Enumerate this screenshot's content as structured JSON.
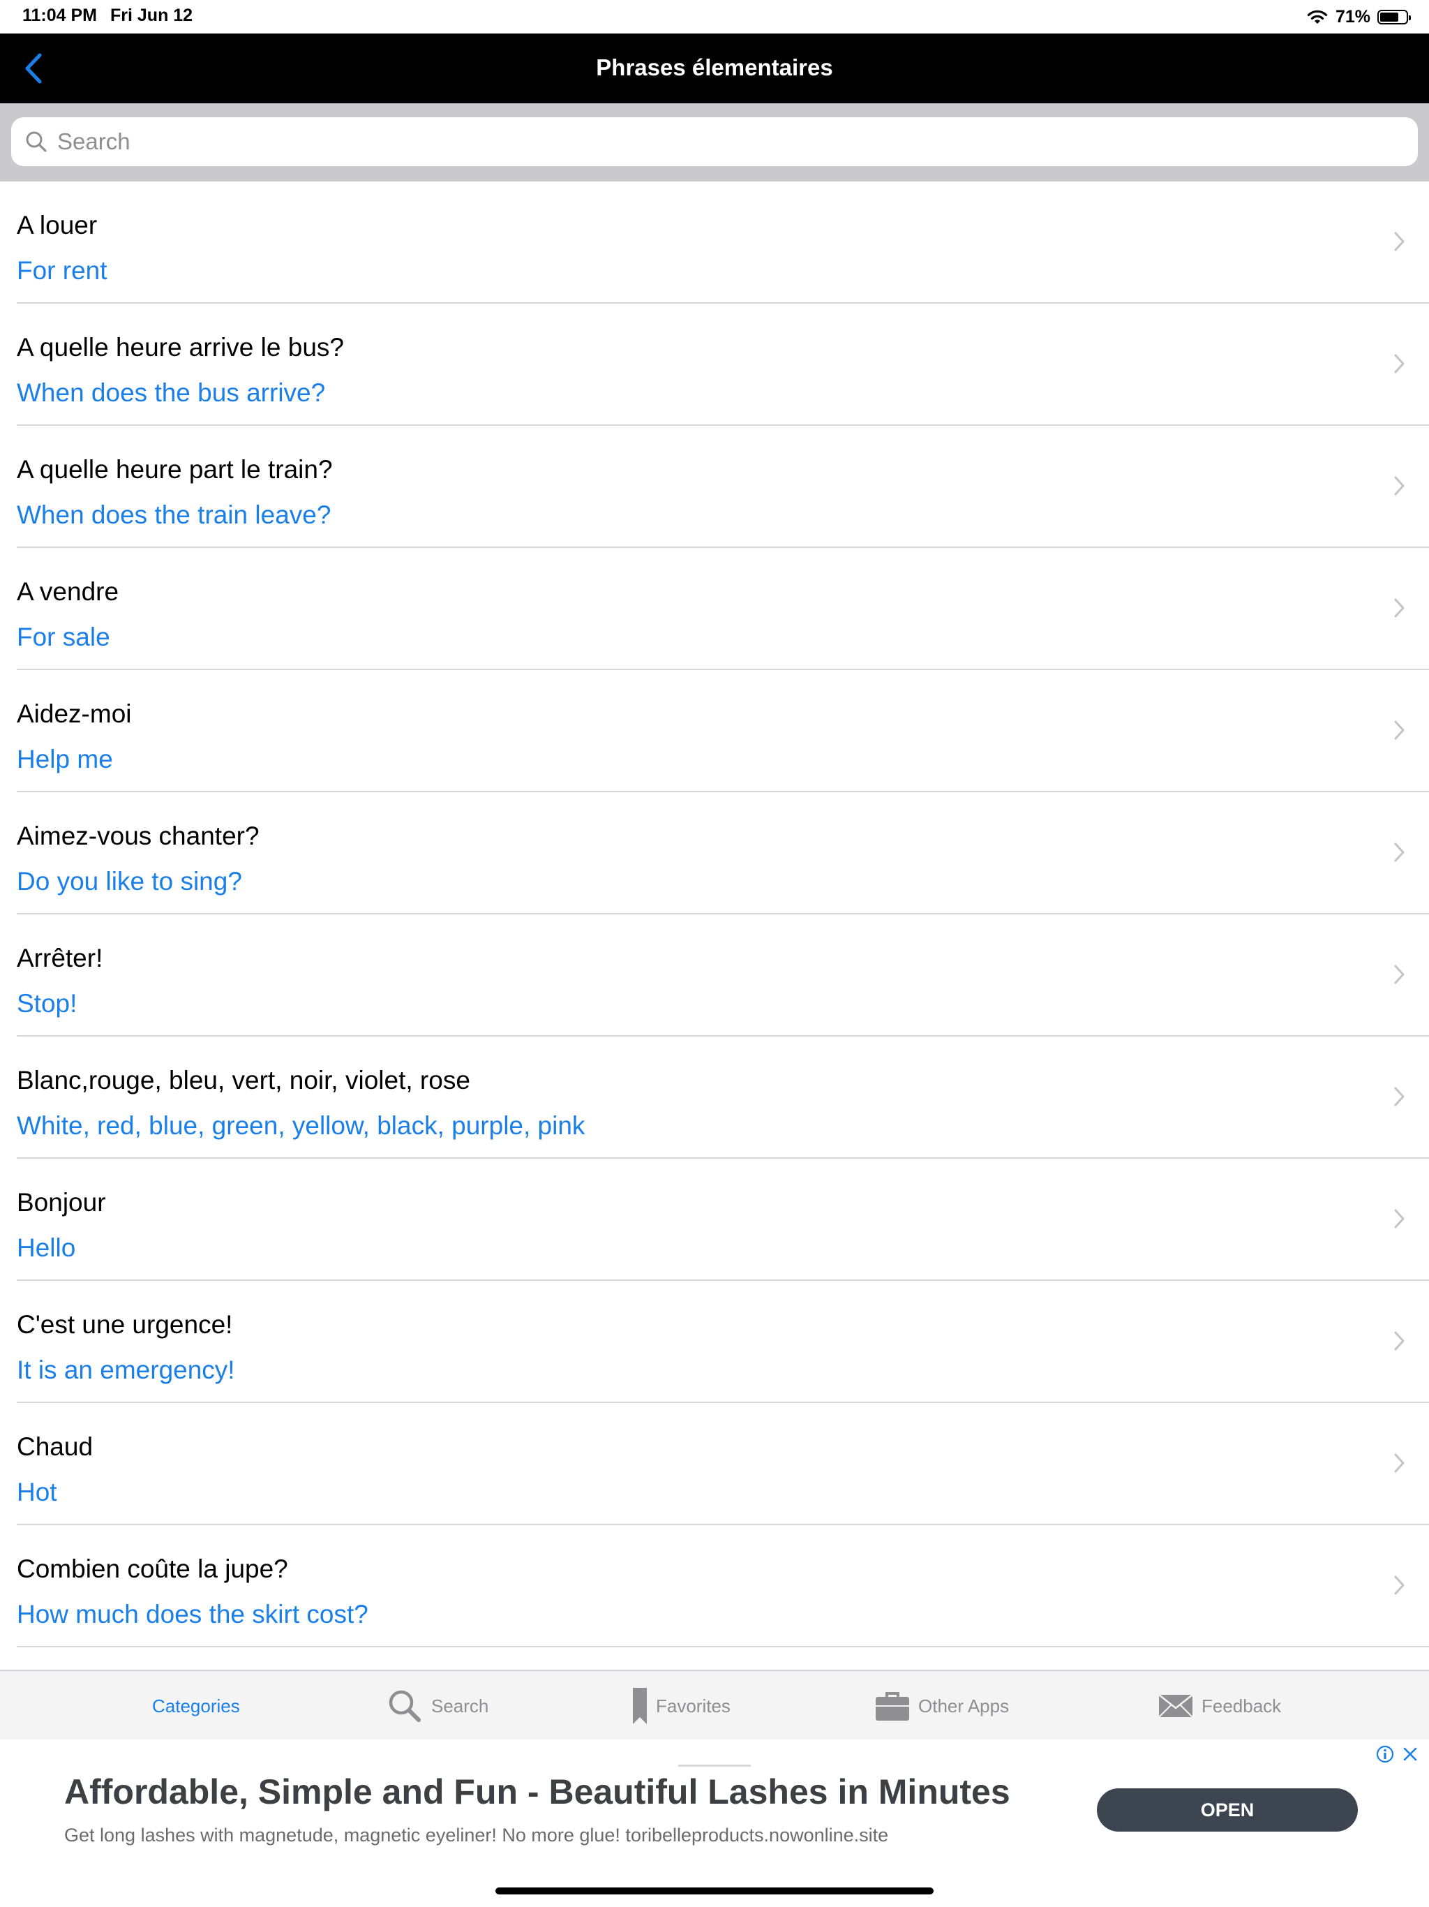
{
  "status_bar": {
    "time": "11:04 PM",
    "date": "Fri Jun 12",
    "battery": "71%",
    "battery_level": 0.71
  },
  "nav": {
    "title": "Phrases élementaires",
    "back_icon": "chevron-left-icon"
  },
  "search": {
    "placeholder": "Search",
    "value": ""
  },
  "phrases": [
    {
      "fr": "A louer",
      "en": "For rent"
    },
    {
      "fr": "A quelle heure arrive le bus?",
      "en": "When does the bus arrive?"
    },
    {
      "fr": "A quelle heure part le train?",
      "en": "When does the train leave?"
    },
    {
      "fr": "A vendre",
      "en": "For sale"
    },
    {
      "fr": "Aidez-moi",
      "en": "Help me"
    },
    {
      "fr": "Aimez-vous chanter?",
      "en": "Do you like to sing?"
    },
    {
      "fr": "Arrêter!",
      "en": "Stop!"
    },
    {
      "fr": "Blanc,rouge, bleu, vert, noir, violet, rose",
      "en": "White, red, blue, green, yellow, black, purple, pink"
    },
    {
      "fr": "Bonjour",
      "en": "Hello"
    },
    {
      "fr": "C'est une urgence!",
      "en": "It is an emergency!"
    },
    {
      "fr": "Chaud",
      "en": "Hot"
    },
    {
      "fr": "Combien coûte la jupe?",
      "en": "How much does the skirt cost?"
    }
  ],
  "tabs": [
    {
      "label": "Categories",
      "icon": "categories-icon",
      "active": true
    },
    {
      "label": "Search",
      "icon": "search-icon",
      "active": false
    },
    {
      "label": "Favorites",
      "icon": "bookmark-icon",
      "active": false
    },
    {
      "label": "Other Apps",
      "icon": "briefcase-icon",
      "active": false
    },
    {
      "label": "Feedback",
      "icon": "envelope-icon",
      "active": false
    }
  ],
  "ad": {
    "title": "Affordable, Simple and Fun - Beautiful Lashes in Minutes",
    "description": "Get long lashes with magnetude, magnetic eyeliner! No more glue! toribelleproducts.nowonline.site",
    "cta": "OPEN"
  },
  "colors": {
    "accent": "#1a7fe8",
    "nav_bg": "#000000",
    "search_bg": "#c9c9ce",
    "ad_button": "#3c4550"
  }
}
